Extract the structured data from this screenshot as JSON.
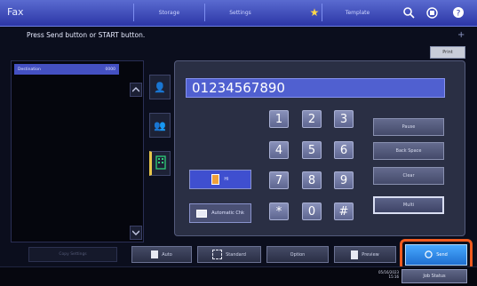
{
  "header": {
    "title": "Fax",
    "tabs": [
      {
        "label": "Storage"
      },
      {
        "label": "Settings"
      },
      {
        "label": "Template"
      }
    ]
  },
  "message": "Press Send button or START button.",
  "print_label": "Print",
  "destination": {
    "label": "Destination",
    "count": "0000"
  },
  "number_display": "01234567890",
  "keypad": [
    "1",
    "2",
    "3",
    "4",
    "5",
    "6",
    "7",
    "8",
    "9",
    "*",
    "0",
    "#"
  ],
  "functions": [
    {
      "label": "Pause"
    },
    {
      "label": "Back Space"
    },
    {
      "label": "Clear"
    },
    {
      "label": "Multi"
    }
  ],
  "modes": [
    {
      "label": "Hi"
    },
    {
      "label": "Automatic Chk"
    }
  ],
  "bottom": {
    "dim_label": "Copy Settings",
    "buttons": [
      {
        "label": "Auto"
      },
      {
        "label": "Standard"
      },
      {
        "label": "Option"
      },
      {
        "label": "Preview"
      }
    ],
    "send_label": "Send"
  },
  "status": {
    "date": "05/16/2023",
    "time": "15:16",
    "job_status": "Job Status"
  },
  "colors": {
    "accent": "#2c36a6",
    "send": "#1f6fd0",
    "highlight": "#f05a1f"
  }
}
